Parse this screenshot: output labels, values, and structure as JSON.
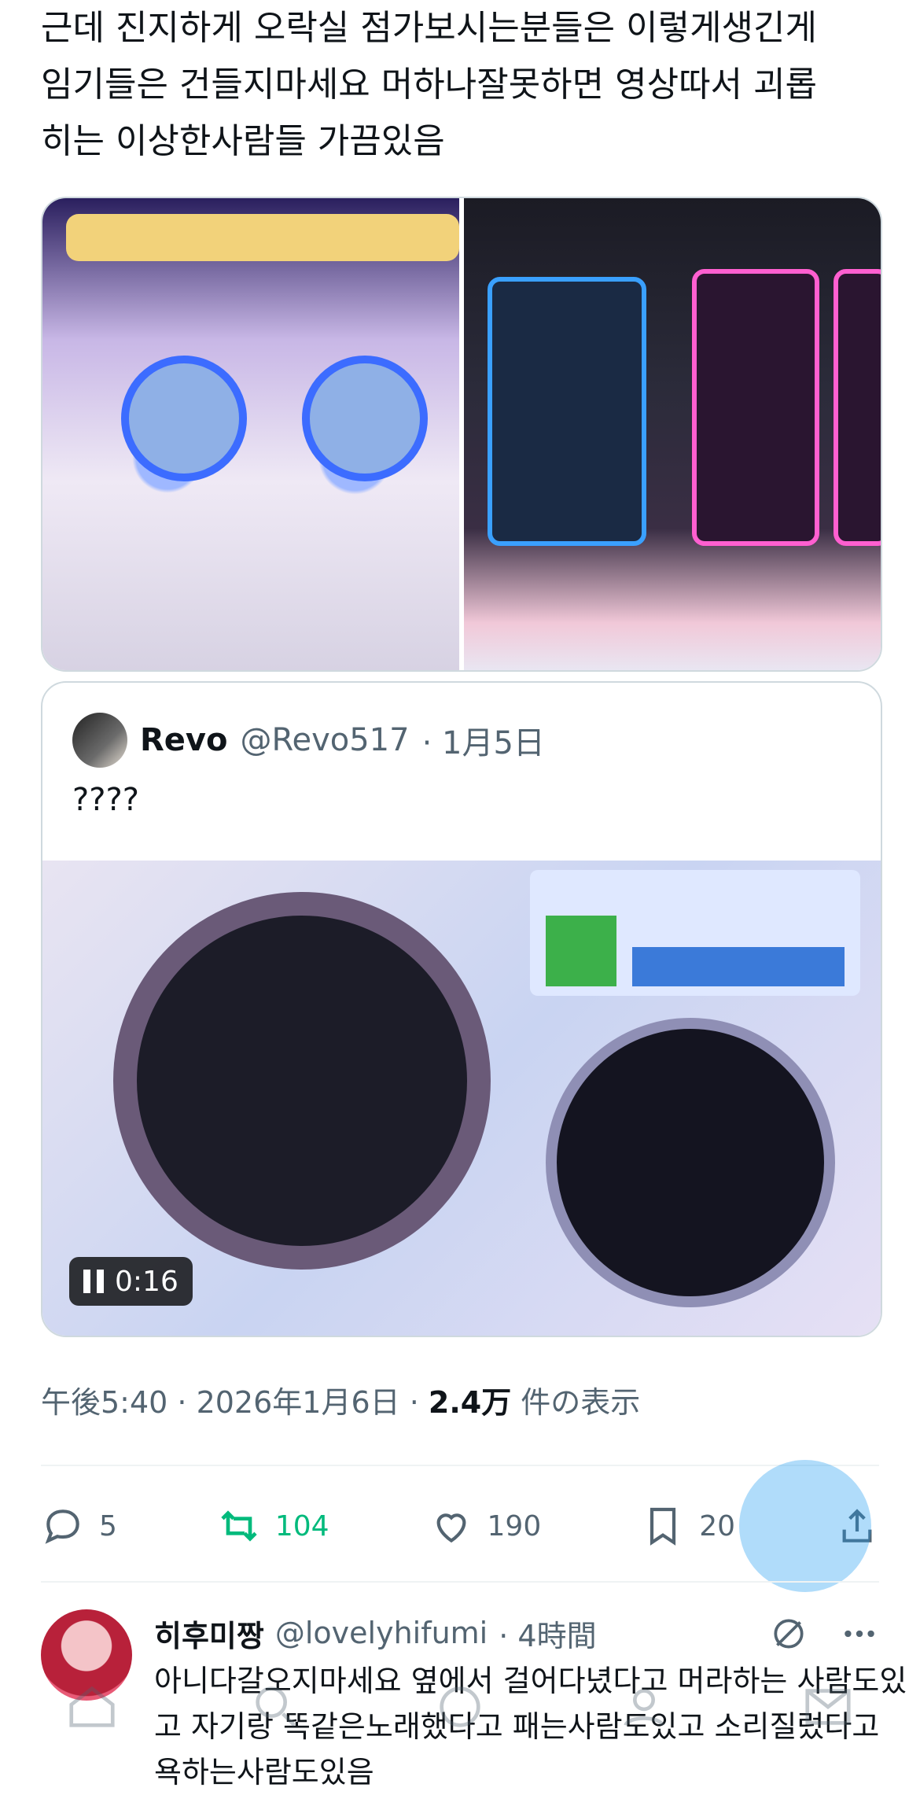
{
  "tweet": {
    "text": "근데 진지하게 오락실 점가보시는분들은 이렇게생긴게\n임기들은 건들지마세요 머하나잘못하면 영상따서 괴롭\n히는 이상한사람들 가끔있음"
  },
  "quote": {
    "name": "Revo",
    "handle": "@Revo517",
    "date": "· 1月5日",
    "text": "????",
    "video_time": "0:16"
  },
  "meta": {
    "time_date": "午後5:40 · 2026年1月6日 · ",
    "views": "2.4万",
    "views_label": " 件の表示"
  },
  "actions": {
    "reply_count": "5",
    "retweet_count": "104",
    "like_count": "190",
    "bookmark_count": "20"
  },
  "reply": {
    "name": "히후미짱",
    "handle": "@lovelyhifumi",
    "time": "· 4時間",
    "text": "아니다갈오지마세요 옆에서 걸어다녔다고 머라하는 사람도있고 자기랑 똑같은노래했다고 패는사람도있고 소리질렀다고 욕하는사람도있음"
  },
  "colors": {
    "retweet_accent": "#00ba7c",
    "secondary_text": "#536471",
    "fab": "#1d9bf0"
  },
  "icons": [
    "reply-icon",
    "retweet-icon",
    "like-icon",
    "bookmark-icon",
    "share-icon",
    "grok-icon",
    "more-icon",
    "pause-icon"
  ]
}
